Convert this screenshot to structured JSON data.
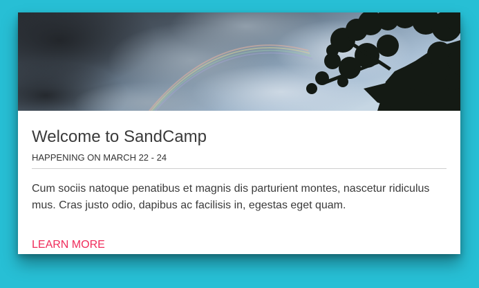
{
  "card": {
    "title": "Welcome to SandCamp",
    "subtitle": "HAPPENING ON MARCH 22 - 24",
    "body": "Cum sociis natoque penatibus et magnis dis parturient montes, nascetur ridiculus mus. Cras justo odio, dapibus ac facilisis in, egestas eget quam.",
    "action_label": "LEARN MORE"
  },
  "colors": {
    "page_background": "#27bfd5",
    "card_background": "#ffffff",
    "action_accent": "#ef2b5a",
    "title_text": "#3a3a3a"
  },
  "hero": {
    "icon": "landscape-image",
    "depicts": [
      "cloudy-sky",
      "rainbow",
      "tree-silhouette"
    ]
  }
}
